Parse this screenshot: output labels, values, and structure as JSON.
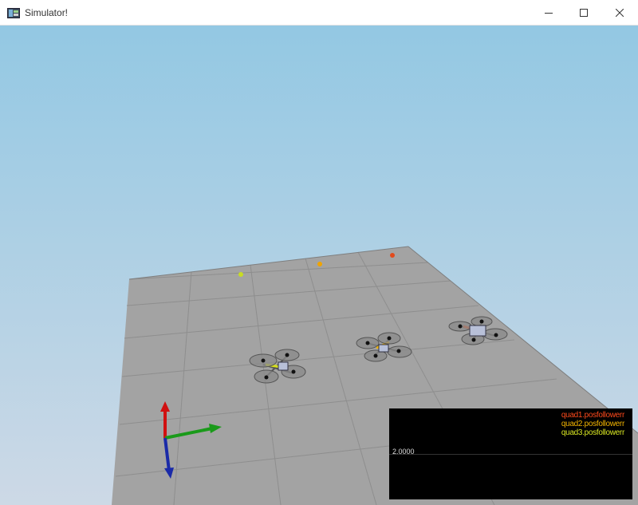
{
  "window": {
    "title": "Simulator!",
    "controls": {
      "minimize_icon": "minimize-icon",
      "maximize_icon": "maximize-icon",
      "close_icon": "close-icon"
    }
  },
  "scene": {
    "sky_top_color": "#93c8e3",
    "sky_bottom_color": "#cdd9e6",
    "floor_color": "#a3a3a3",
    "grid_line_color": "#8e8e8e",
    "quads": [
      {
        "name": "quad1",
        "arm_color": "#e85a2a",
        "target_color": "#e24a1c"
      },
      {
        "name": "quad2",
        "arm_color": "#f2b400",
        "target_color": "#f0a400"
      },
      {
        "name": "quad3",
        "arm_color": "#d6e01c",
        "target_color": "#c8dc22"
      }
    ],
    "axes": {
      "x_color": "#1a9a1a",
      "y_color": "#d01010",
      "z_color": "#1a2aa8"
    }
  },
  "plot": {
    "y_label": "2.0000",
    "series": [
      {
        "name": "quad1.posfollowerr",
        "color": "#ff4a1c"
      },
      {
        "name": "quad2.posfollowerr",
        "color": "#f2b400"
      },
      {
        "name": "quad3.posfollowerr",
        "color": "#d8e622"
      }
    ]
  }
}
